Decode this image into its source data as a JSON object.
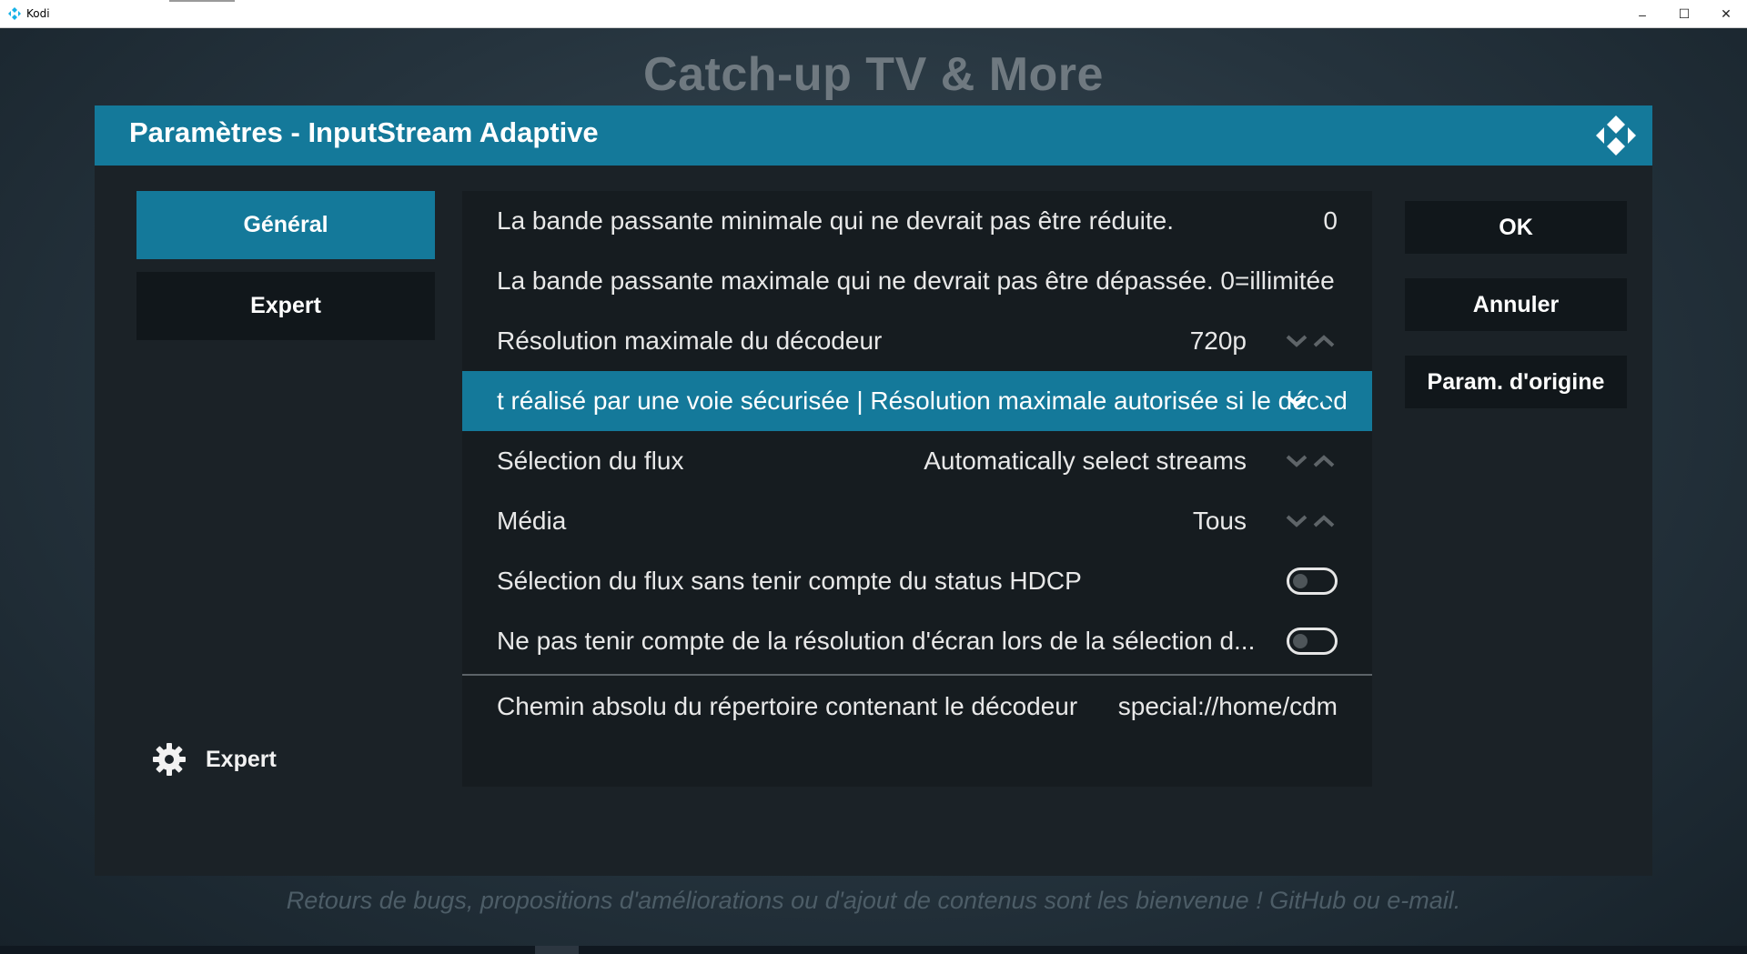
{
  "window": {
    "title": "Kodi",
    "minimize": "–",
    "maximize": "☐",
    "close": "✕"
  },
  "background": {
    "addon_title": "Catch-up TV & More",
    "footer_message": "Retours de bugs, propositions d'améliorations ou d'ajout de contenus sont les bienvenue ! GitHub ou e-mail."
  },
  "dialog": {
    "title": "Paramètres - InputStream Adaptive",
    "categories": [
      {
        "label": "Général",
        "active": true
      },
      {
        "label": "Expert",
        "active": false
      }
    ],
    "settings_level": {
      "label": "Expert",
      "icon": "gear-icon"
    },
    "settings": [
      {
        "label": "La bande passante minimale qui ne devrait pas être réduite.",
        "value": "0",
        "control": "value"
      },
      {
        "label": "La bande passante maximale qui ne devrait pas être dépassée. 0=illimitée",
        "value": "",
        "control": "value"
      },
      {
        "label": "Résolution maximale du décodeur",
        "value": "720p",
        "control": "spinner"
      },
      {
        "label": "t réalisé par une voie sécurisée | Résolution maximale autorisée si le décod",
        "value": "",
        "control": "spinner-selected"
      },
      {
        "label": "Sélection du flux",
        "value": "Automatically select streams",
        "control": "spinner"
      },
      {
        "label": "Média",
        "value": "Tous",
        "control": "spinner"
      },
      {
        "label": "Sélection du flux sans tenir compte du status HDCP",
        "value": "off",
        "control": "toggle"
      },
      {
        "label": "Ne pas tenir compte de la résolution d'écran lors de la sélection d...",
        "value": "off",
        "control": "toggle"
      },
      {
        "label": "Chemin absolu du répertoire contenant le décodeur",
        "value": "special://home/cdm",
        "control": "value"
      }
    ],
    "buttons": {
      "ok": "OK",
      "cancel": "Annuler",
      "defaults": "Param. d'origine"
    }
  },
  "colors": {
    "accent": "#14799a",
    "panel": "#161c20",
    "dialog": "#1b2227"
  }
}
